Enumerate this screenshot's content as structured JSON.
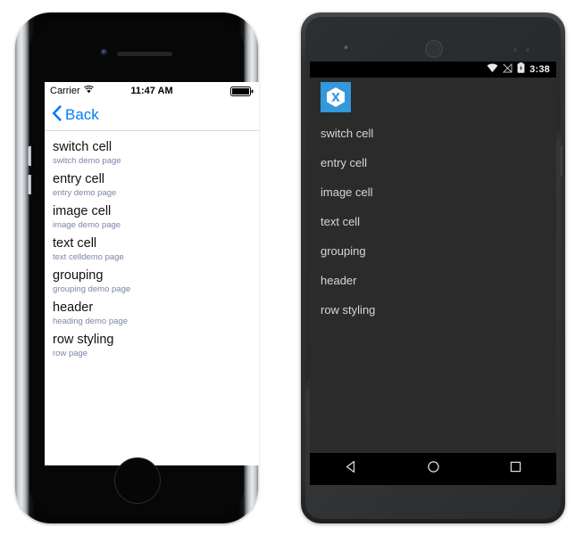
{
  "ios": {
    "device_name": "iphone-device",
    "status_bar": {
      "carrier": "Carrier",
      "wifi_icon": "wifi-icon",
      "time": "11:47 AM",
      "battery_icon": "battery-full-icon"
    },
    "nav_bar": {
      "back_icon": "chevron-left-icon",
      "back_label": "Back"
    },
    "list": [
      {
        "title": "switch cell",
        "detail": "switch demo page"
      },
      {
        "title": "entry cell",
        "detail": "entry demo page"
      },
      {
        "title": "image cell",
        "detail": "image demo page"
      },
      {
        "title": "text cell",
        "detail": "text celldemo page"
      },
      {
        "title": "grouping",
        "detail": "grouping demo page"
      },
      {
        "title": "header",
        "detail": "heading demo page"
      },
      {
        "title": "row styling",
        "detail": "row page"
      }
    ],
    "colors": {
      "accent": "#007aff",
      "title_text": "#111111",
      "detail_text": "#7a86a8",
      "screen_bg": "#ffffff"
    }
  },
  "android": {
    "device_name": "android-device",
    "status_bar": {
      "wifi_icon": "wifi-icon",
      "signal_icon": "signal-no-service-icon",
      "battery_icon": "battery-charging-icon",
      "time": "3:38"
    },
    "app_bar": {
      "app_icon": "xamarin-logo-icon"
    },
    "list": [
      {
        "title": "switch cell"
      },
      {
        "title": "entry cell"
      },
      {
        "title": "image cell"
      },
      {
        "title": "text cell"
      },
      {
        "title": "grouping"
      },
      {
        "title": "header"
      },
      {
        "title": "row styling"
      }
    ],
    "nav_bar": {
      "back_icon": "nav-back-triangle-icon",
      "home_icon": "nav-home-circle-icon",
      "recents_icon": "nav-recents-square-icon"
    },
    "colors": {
      "brand": "#3498db",
      "screen_bg": "#2b2b2b",
      "list_text": "#d6d6d6",
      "status_bg": "#000000"
    }
  }
}
